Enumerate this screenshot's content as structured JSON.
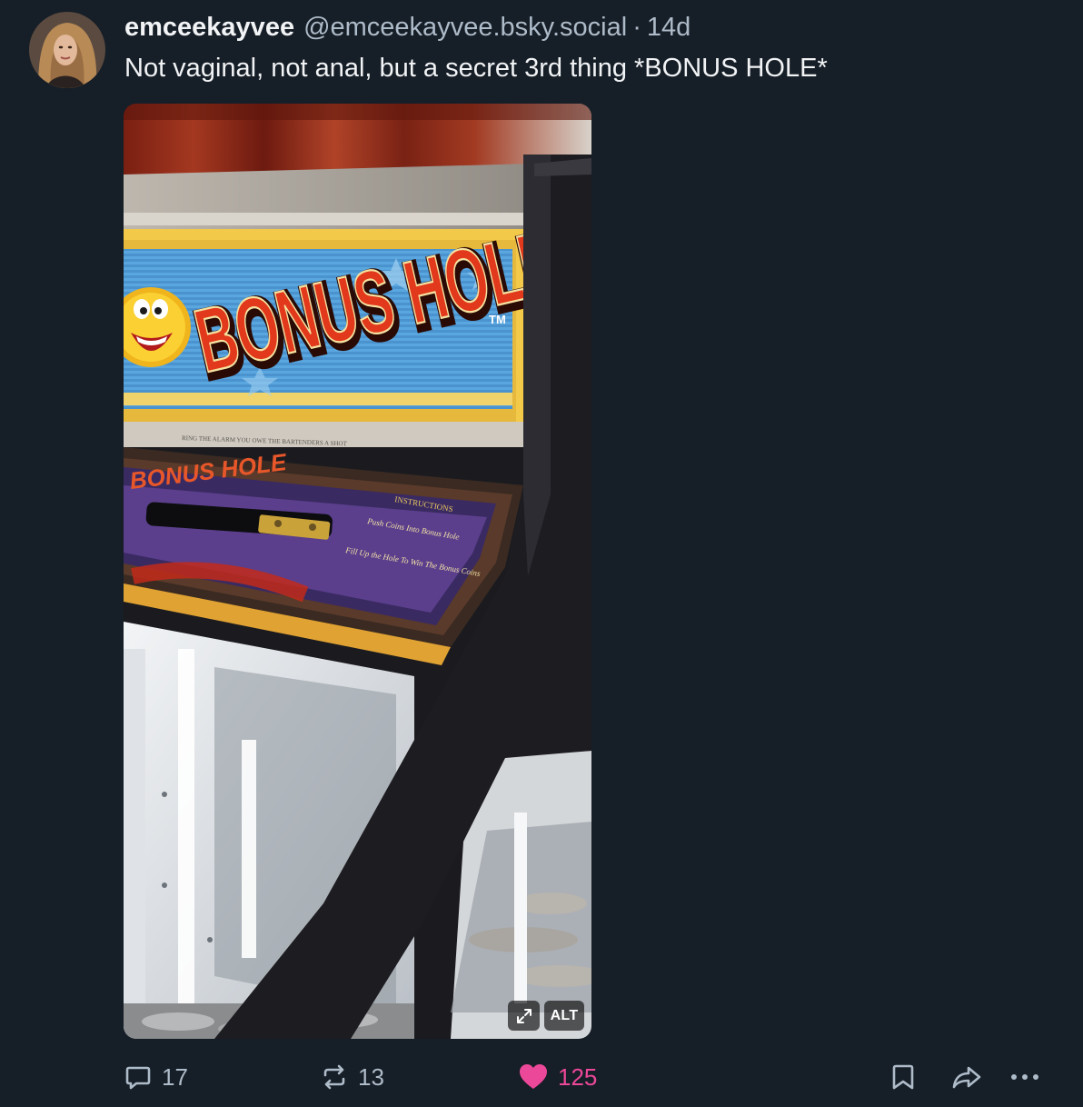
{
  "author": {
    "display_name": "emceekayvee",
    "handle": "@emceekayvee.bsky.social",
    "separator": "·",
    "timestamp": "14d",
    "avatar_icon": "avatar-photo"
  },
  "post": {
    "text": "Not vaginal, not anal, but a secret 3rd thing *BONUS HOLE*"
  },
  "media": {
    "sign_text": "BONUS HOLE",
    "tm_text": "TM",
    "small_print": "RING THE ALARM YOU OWE THE BARTENDERS A SHOT",
    "panel_logo": "BONUS HOLE",
    "panel_instructions_title": "INSTRUCTIONS",
    "panel_line1": "Push Coins Into Bonus Hole",
    "panel_line2": "Fill Up the Hole To Win The Bonus Coins",
    "expand_icon": "expand-icon",
    "alt_label": "ALT"
  },
  "actions": {
    "reply_icon": "reply-icon",
    "reply_count": "17",
    "repost_icon": "repost-icon",
    "repost_count": "13",
    "like_icon": "heart-icon",
    "like_count": "125",
    "bookmark_icon": "bookmark-icon",
    "share_icon": "share-icon",
    "more_icon": "more-icon"
  },
  "colors": {
    "background": "#161e27",
    "text_primary": "#f1f3f5",
    "text_secondary": "#aebbc9",
    "like_pink": "#ec4899"
  }
}
